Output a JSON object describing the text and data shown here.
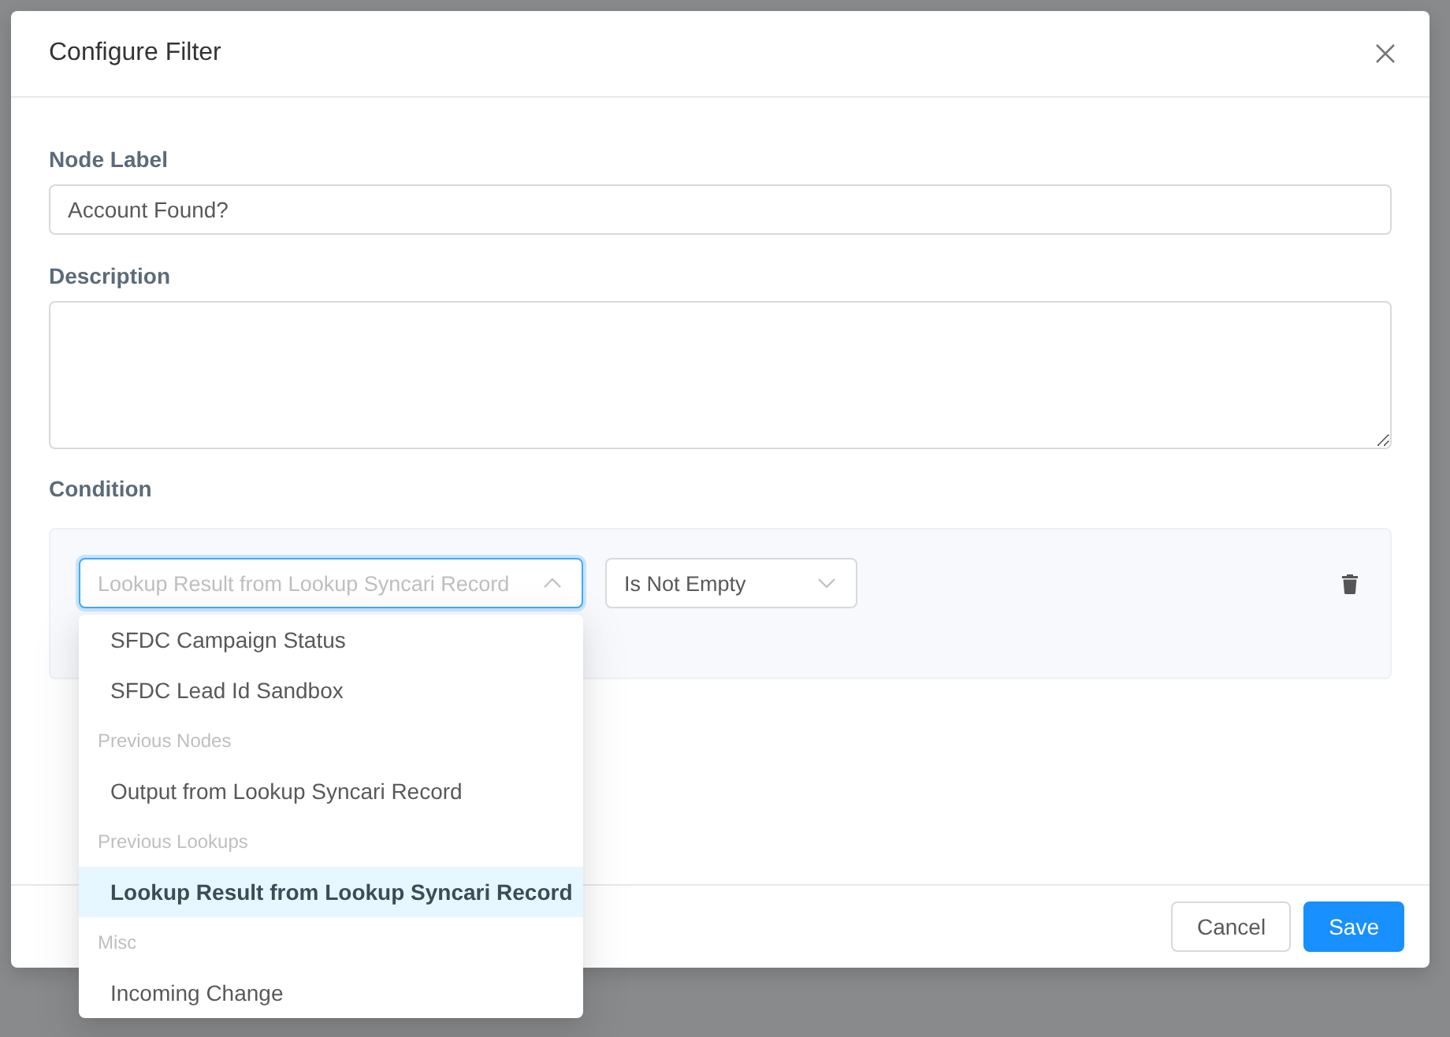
{
  "dialog": {
    "title": "Configure Filter"
  },
  "fields": [
    {
      "kind": "input",
      "label": "Node Label",
      "value": "Account Found?"
    },
    {
      "kind": "textarea",
      "label": "Description"
    }
  ],
  "condition": {
    "label": "Condition",
    "field_select": {
      "placeholder": "Lookup Result from Lookup Syncari Record",
      "expanded": true
    },
    "operator_select": {
      "value": "Is Not Empty",
      "expanded": false
    }
  },
  "dropdown": {
    "sections": [
      {
        "options": [
          {
            "label": "SFDC Campaign Status",
            "selected": false
          },
          {
            "label": "SFDC Lead Id Sandbox",
            "selected": false
          }
        ]
      },
      {
        "heading": "Previous Nodes",
        "options": [
          {
            "label": "Output from Lookup Syncari Record",
            "selected": false
          }
        ]
      },
      {
        "heading": "Previous Lookups",
        "options": [
          {
            "label": "Lookup Result from Lookup Syncari Record",
            "selected": true
          }
        ]
      },
      {
        "heading": "Misc",
        "options": [
          {
            "label": "Incoming Change",
            "selected": false
          }
        ]
      }
    ]
  },
  "buttons": [
    {
      "kind": "default",
      "label": "Cancel"
    },
    {
      "kind": "primary",
      "label": "Save"
    }
  ]
}
